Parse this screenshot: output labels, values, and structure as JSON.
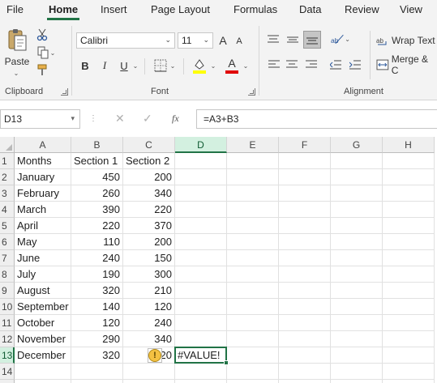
{
  "tabs": [
    "File",
    "Home",
    "Insert",
    "Page Layout",
    "Formulas",
    "Data",
    "Review",
    "View"
  ],
  "active_tab": "Home",
  "clipboard": {
    "paste_label": "Paste",
    "group_label": "Clipboard"
  },
  "font": {
    "name": "Calibri",
    "size": "11",
    "group_label": "Font",
    "bold": "B",
    "italic": "I",
    "underline": "U",
    "grow": "A",
    "shrink": "A",
    "font_color_letter": "A",
    "highlight_color": "#ffff00",
    "font_color": "#e00000"
  },
  "alignment": {
    "wrap_text": "Wrap Text",
    "merge": "Merge & C",
    "group_label": "Alignment"
  },
  "formula_bar": {
    "name_box": "D13",
    "formula": "=A3+B3",
    "fx": "fx"
  },
  "columns": [
    "A",
    "B",
    "C",
    "D",
    "E",
    "F",
    "G",
    "H"
  ],
  "rows": [
    "1",
    "2",
    "3",
    "4",
    "5",
    "6",
    "7",
    "8",
    "9",
    "10",
    "11",
    "12",
    "13",
    "14",
    "15"
  ],
  "sheet": {
    "header": [
      "Months",
      "Section 1",
      "Section 2"
    ],
    "data": [
      [
        "January",
        "450",
        "200"
      ],
      [
        "February",
        "260",
        "340"
      ],
      [
        "March",
        "390",
        "220"
      ],
      [
        "April",
        "220",
        "370"
      ],
      [
        "May",
        "110",
        "200"
      ],
      [
        "June",
        "240",
        "150"
      ],
      [
        "July",
        "190",
        "300"
      ],
      [
        "August",
        "320",
        "210"
      ],
      [
        " September",
        "140",
        "120"
      ],
      [
        "October",
        "120",
        "240"
      ],
      [
        "November",
        "290",
        "340"
      ],
      [
        "December",
        "320",
        "20"
      ]
    ],
    "d13": "#VALUE!",
    "error_glyph": "!"
  },
  "colors": {
    "accent": "#217346",
    "selected_header": "#d3f0e0"
  }
}
